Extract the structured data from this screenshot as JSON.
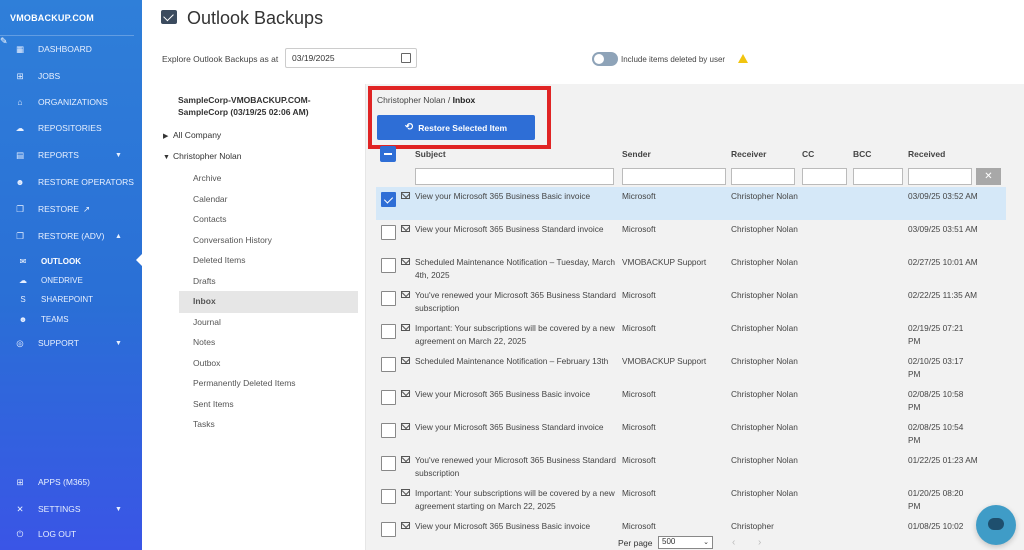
{
  "sidebar": {
    "brand": "VMOBACKUP.COM",
    "nav": [
      {
        "label": "DASHBOARD",
        "icon": "dashboard-icon"
      },
      {
        "label": "JOBS",
        "icon": "windows-icon"
      },
      {
        "label": "ORGANIZATIONS",
        "icon": "bank-icon"
      },
      {
        "label": "REPOSITORIES",
        "icon": "cloud-icon"
      },
      {
        "label": "REPORTS",
        "icon": "report-icon"
      },
      {
        "label": "RESTORE OPERATORS",
        "icon": "users-icon"
      },
      {
        "label": "RESTORE",
        "icon": "restore-icon"
      },
      {
        "label": "RESTORE (ADV)",
        "icon": "restore-adv-icon"
      }
    ],
    "sub": [
      {
        "label": "OUTLOOK",
        "icon": "outlook-icon"
      },
      {
        "label": "ONEDRIVE",
        "icon": "onedrive-icon"
      },
      {
        "label": "SHAREPOINT",
        "icon": "sharepoint-icon"
      },
      {
        "label": "TEAMS",
        "icon": "teams-icon"
      }
    ],
    "support": "SUPPORT",
    "apps": "APPS (M365)",
    "settings": "SETTINGS",
    "logout": "LOG OUT"
  },
  "header": {
    "title": "Outlook Backups",
    "explore_label": "Explore Outlook Backups as at",
    "date": "03/19/2025",
    "toggle_label": "Include items deleted by user"
  },
  "tree": {
    "root": "SampleCorp-VMOBACKUP.COM-SampleCorp (03/19/25 02:06 AM)",
    "all_company": "All Company",
    "user": "Christopher Nolan",
    "folders": [
      "Archive",
      "Calendar",
      "Contacts",
      "Conversation History",
      "Deleted Items",
      "Drafts",
      "Inbox",
      "Journal",
      "Notes",
      "Outbox",
      "Permanently Deleted Items",
      "Sent Items",
      "Tasks"
    ]
  },
  "breadcrumb": {
    "path": "Christopher Nolan / ",
    "current": "Inbox"
  },
  "restore_button": "Restore Selected Item",
  "table": {
    "columns": [
      "Subject",
      "Sender",
      "Receiver",
      "CC",
      "BCC",
      "Received"
    ],
    "rows": [
      {
        "subject": "View your Microsoft 365 Business Basic invoice",
        "sender": "Microsoft",
        "receiver": "Christopher Nolan",
        "received": "03/09/25 03:52 AM",
        "selected": true
      },
      {
        "subject": "View your Microsoft 365 Business Standard invoice",
        "sender": "Microsoft",
        "receiver": "Christopher Nolan",
        "received": "03/09/25 03:51 AM",
        "selected": false
      },
      {
        "subject": "Scheduled Maintenance Notification – Tuesday, March 4th, 2025",
        "sender": "VMOBACKUP Support",
        "receiver": "Christopher Nolan",
        "received": "02/27/25 10:01 AM",
        "selected": false
      },
      {
        "subject": "You've renewed your Microsoft 365 Business Standard subscription",
        "sender": "Microsoft",
        "receiver": "Christopher Nolan",
        "received": "02/22/25 11:35 AM",
        "selected": false
      },
      {
        "subject": "Important: Your subscriptions will be covered by a new agreement on March 22, 2025",
        "sender": "Microsoft",
        "receiver": "Christopher Nolan",
        "received": "02/19/25 07:21 PM",
        "selected": false
      },
      {
        "subject": "Scheduled Maintenance Notification – February 13th",
        "sender": "VMOBACKUP Support",
        "receiver": "Christopher Nolan",
        "received": "02/10/25 03:17 PM",
        "selected": false
      },
      {
        "subject": "View your Microsoft 365 Business Basic invoice",
        "sender": "Microsoft",
        "receiver": "Christopher Nolan",
        "received": "02/08/25 10:58 PM",
        "selected": false
      },
      {
        "subject": "View your Microsoft 365 Business Standard invoice",
        "sender": "Microsoft",
        "receiver": "Christopher Nolan",
        "received": "02/08/25 10:54 PM",
        "selected": false
      },
      {
        "subject": "You've renewed your Microsoft 365 Business Standard subscription",
        "sender": "Microsoft",
        "receiver": "Christopher Nolan",
        "received": "01/22/25 01:23 AM",
        "selected": false
      },
      {
        "subject": "Important: Your subscriptions will be covered by a new agreement starting on March 22, 2025",
        "sender": "Microsoft",
        "receiver": "Christopher Nolan",
        "received": "01/20/25 08:20 PM",
        "selected": false
      },
      {
        "subject": "View your Microsoft 365 Business Basic invoice",
        "sender": "Microsoft",
        "receiver": "Christopher",
        "received": "01/08/25 10:02",
        "selected": false
      }
    ]
  },
  "pager": {
    "label": "Per page",
    "value": "500"
  },
  "colors": {
    "sidebar": "#2f7fd9",
    "accent": "#2e6ed6",
    "highlight_box": "#e02424",
    "selected_row": "#d5e8f8"
  }
}
